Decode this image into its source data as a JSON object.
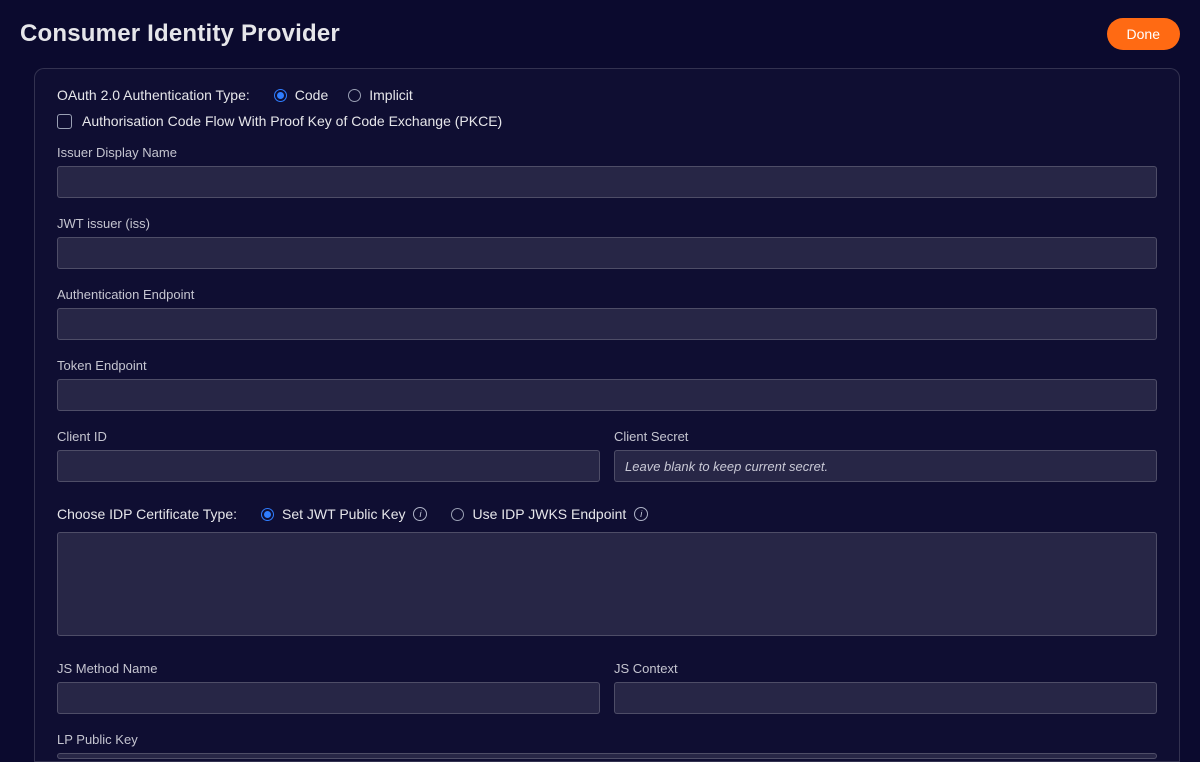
{
  "header": {
    "title": "Consumer Identity Provider",
    "done_label": "Done"
  },
  "form": {
    "auth_type_label": "OAuth 2.0 Authentication Type:",
    "auth_type_options": {
      "code": "Code",
      "implicit": "Implicit",
      "selected": "code"
    },
    "pkce_checkbox_label": "Authorisation Code Flow With Proof Key of Code Exchange (PKCE)",
    "pkce_checked": false,
    "issuer_display_name_label": "Issuer Display Name",
    "issuer_display_name_value": "",
    "jwt_issuer_label": "JWT issuer (iss)",
    "jwt_issuer_value": "",
    "auth_endpoint_label": "Authentication Endpoint",
    "auth_endpoint_value": "",
    "token_endpoint_label": "Token Endpoint",
    "token_endpoint_value": "",
    "client_id_label": "Client ID",
    "client_id_value": "",
    "client_secret_label": "Client Secret",
    "client_secret_placeholder": "Leave blank to keep current secret.",
    "client_secret_value": "",
    "cert_type_label": "Choose IDP Certificate Type:",
    "cert_options": {
      "set_jwt": "Set JWT Public Key",
      "use_jwks": "Use IDP JWKS Endpoint",
      "selected": "set_jwt"
    },
    "cert_textarea_value": "",
    "js_method_name_label": "JS Method Name",
    "js_method_name_value": "",
    "js_context_label": "JS Context",
    "js_context_value": "",
    "lp_public_key_label": "LP Public Key"
  }
}
